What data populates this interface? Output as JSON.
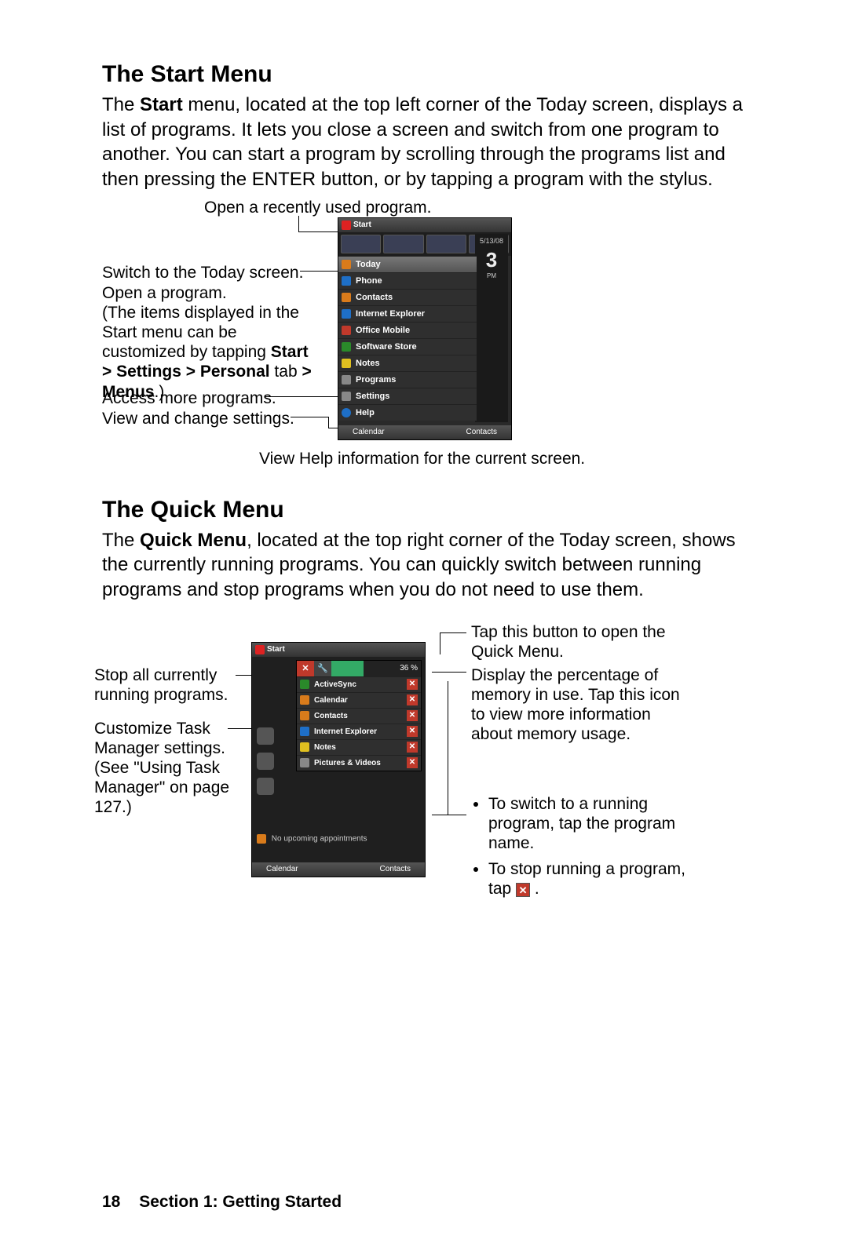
{
  "section1": {
    "heading": "The Start Menu",
    "para_prefix": "The ",
    "para_bold1": "Start",
    "para_after": " menu, located at the top left corner of the Today screen, displays a list of programs. It lets you close a screen and switch from one program to another. You can start a program by scrolling through the programs list and then pressing the ENTER button, or by tapping a program with the stylus."
  },
  "fig1": {
    "top": "Open a recently used program.",
    "left_a": "Switch to the Today screen.",
    "left_b_1": "Open a program.",
    "left_b_2": "(The items displayed in the Start menu can be customized by tapping ",
    "left_b_bold": "Start > Settings > Personal",
    "left_b_3": " tab ",
    "left_b_bold2": "> Menus",
    "left_b_4": ".)",
    "left_c": "Access more programs.",
    "left_d": "View and change settings.",
    "bottom": "View Help information for the current screen.",
    "phone": {
      "start": "Start",
      "date": "5/13/08",
      "time_big": "3",
      "ampm": "PM",
      "menu_items": [
        "Today",
        "Phone",
        "Contacts",
        "Internet Explorer",
        "Office Mobile",
        "Software Store",
        "Notes",
        "Programs",
        "Settings",
        "Help"
      ],
      "soft_left": "Calendar",
      "soft_right": "Contacts"
    }
  },
  "section2": {
    "heading": "The Quick Menu",
    "para_prefix": "The ",
    "para_bold1": "Quick Menu",
    "para_after": ", located at the top right corner of the Today screen, shows the currently running programs. You can quickly switch between running programs and stop programs when you do not need to use them."
  },
  "fig2": {
    "left_a": "Stop all currently running programs.",
    "left_b": "Customize Task Manager settings. (See \"Using Task Manager\" on page 127.)",
    "right_a": "Tap this button to open the Quick Menu.",
    "right_b": "Display the percentage of memory in use. Tap this icon to view more information about memory usage.",
    "right_c_1": "To switch to a running program, tap the program name.",
    "right_c_2a": "To stop running a program, tap ",
    "right_c_2b": " .",
    "phone": {
      "start": "Start",
      "mem": "36 %",
      "rows": [
        "ActiveSync",
        "Calendar",
        "Contacts",
        "Internet Explorer",
        "Notes",
        "Pictures & Videos"
      ],
      "appt": "No upcoming appointments",
      "soft_left": "Calendar",
      "soft_right": "Contacts"
    }
  },
  "footer": {
    "page": "18",
    "section": "Section 1: Getting Started"
  }
}
